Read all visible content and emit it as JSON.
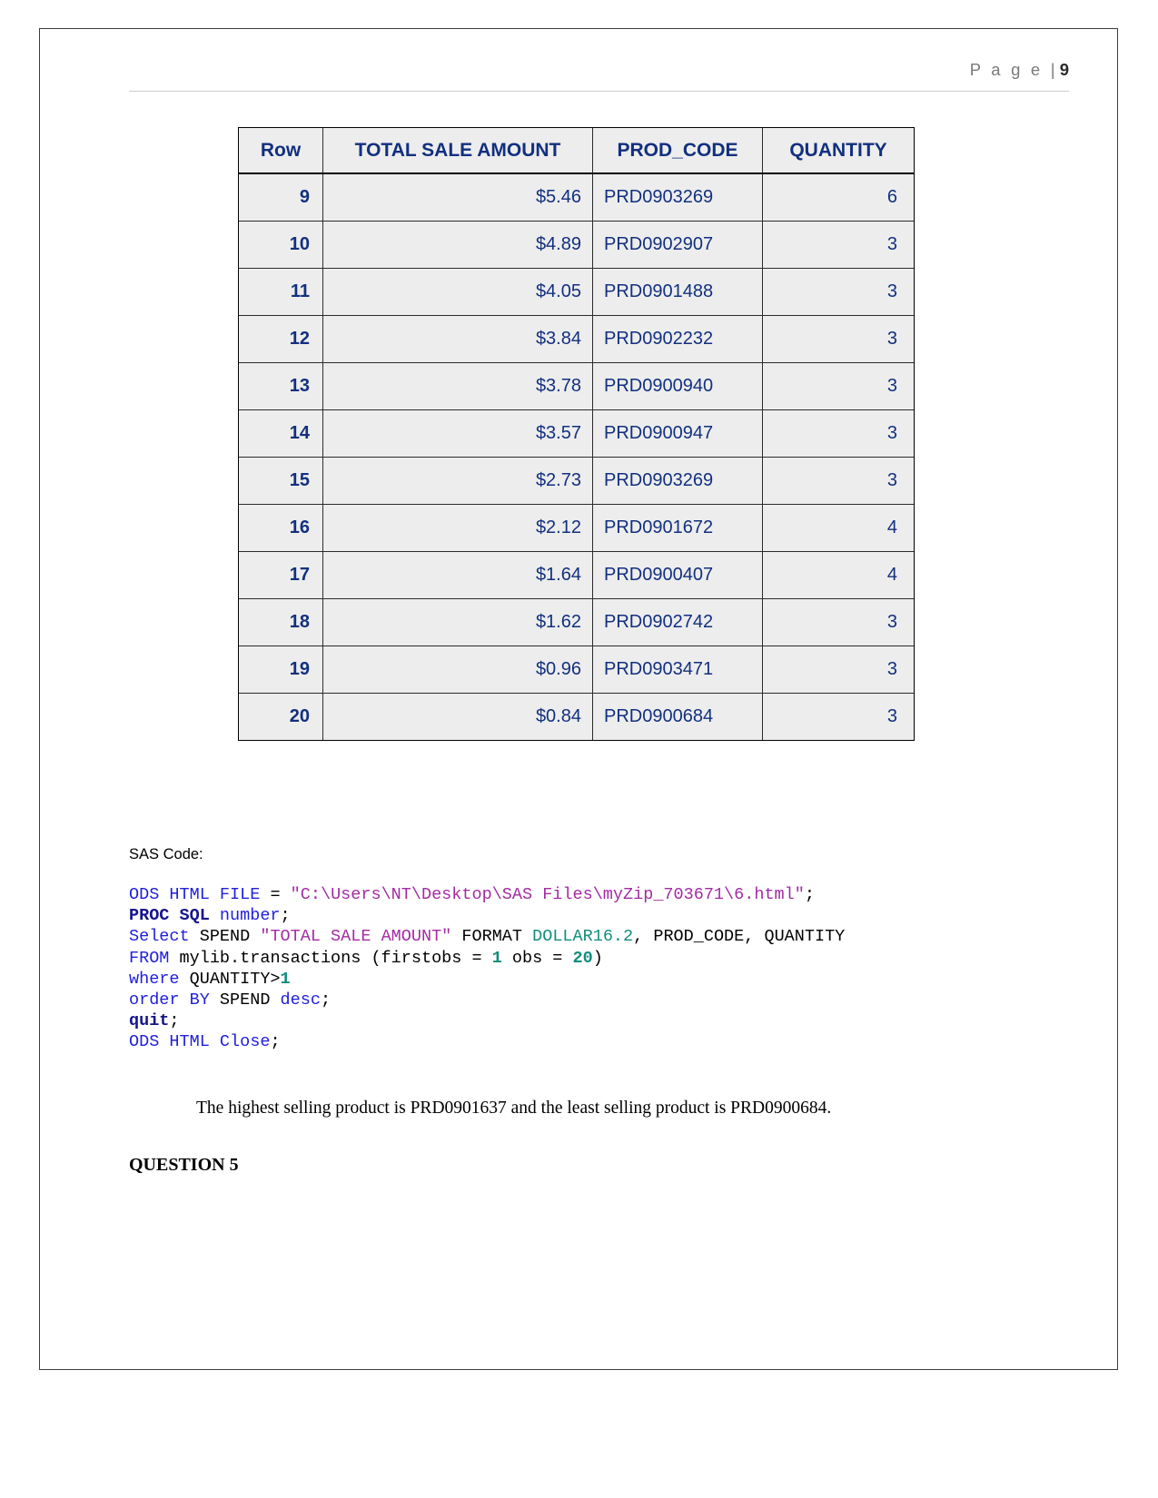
{
  "header": {
    "page_word": "P a g e ",
    "separator": "| ",
    "page_number": "9"
  },
  "table": {
    "columns": [
      "Row",
      "TOTAL SALE AMOUNT",
      "PROD_CODE",
      "QUANTITY"
    ],
    "rows": [
      {
        "row": "9",
        "amount": "$5.46",
        "prod_code": "PRD0903269",
        "quantity": "6"
      },
      {
        "row": "10",
        "amount": "$4.89",
        "prod_code": "PRD0902907",
        "quantity": "3"
      },
      {
        "row": "11",
        "amount": "$4.05",
        "prod_code": "PRD0901488",
        "quantity": "3"
      },
      {
        "row": "12",
        "amount": "$3.84",
        "prod_code": "PRD0902232",
        "quantity": "3"
      },
      {
        "row": "13",
        "amount": "$3.78",
        "prod_code": "PRD0900940",
        "quantity": "3"
      },
      {
        "row": "14",
        "amount": "$3.57",
        "prod_code": "PRD0900947",
        "quantity": "3"
      },
      {
        "row": "15",
        "amount": "$2.73",
        "prod_code": "PRD0903269",
        "quantity": "3"
      },
      {
        "row": "16",
        "amount": "$2.12",
        "prod_code": "PRD0901672",
        "quantity": "4"
      },
      {
        "row": "17",
        "amount": "$1.64",
        "prod_code": "PRD0900407",
        "quantity": "4"
      },
      {
        "row": "18",
        "amount": "$1.62",
        "prod_code": "PRD0902742",
        "quantity": "3"
      },
      {
        "row": "19",
        "amount": "$0.96",
        "prod_code": "PRD0903471",
        "quantity": "3"
      },
      {
        "row": "20",
        "amount": "$0.84",
        "prod_code": "PRD0900684",
        "quantity": "3"
      }
    ]
  },
  "sas_section": {
    "label": "SAS Code:",
    "code_lines": [
      {
        "tokens": [
          {
            "t": "ODS HTML FILE ",
            "c": "kw"
          },
          {
            "t": "= ",
            "c": "plain"
          },
          {
            "t": "\"C:\\Users\\NT\\Desktop\\SAS Files\\myZip_703671\\6.html\"",
            "c": "str"
          },
          {
            "t": ";",
            "c": "plain"
          }
        ]
      },
      {
        "tokens": [
          {
            "t": "PROC SQL ",
            "c": "kwb"
          },
          {
            "t": "number",
            "c": "kw"
          },
          {
            "t": ";",
            "c": "plain"
          }
        ]
      },
      {
        "tokens": [
          {
            "t": "Select",
            "c": "kw"
          },
          {
            "t": " SPEND ",
            "c": "plain"
          },
          {
            "t": "\"TOTAL SALE AMOUNT\"",
            "c": "str"
          },
          {
            "t": " FORMAT ",
            "c": "plain"
          },
          {
            "t": "DOLLAR16.2",
            "c": "fmt"
          },
          {
            "t": ", PROD_CODE, QUANTITY",
            "c": "plain"
          }
        ]
      },
      {
        "tokens": [
          {
            "t": "FROM",
            "c": "kw"
          },
          {
            "t": " mylib.transactions (firstobs = ",
            "c": "plain"
          },
          {
            "t": "1",
            "c": "num"
          },
          {
            "t": " obs = ",
            "c": "plain"
          },
          {
            "t": "20",
            "c": "num"
          },
          {
            "t": ")",
            "c": "plain"
          }
        ]
      },
      {
        "tokens": [
          {
            "t": "where",
            "c": "kw"
          },
          {
            "t": " QUANTITY>",
            "c": "plain"
          },
          {
            "t": "1",
            "c": "num"
          }
        ]
      },
      {
        "tokens": [
          {
            "t": "order BY",
            "c": "kw"
          },
          {
            "t": " SPEND ",
            "c": "plain"
          },
          {
            "t": "desc",
            "c": "kw"
          },
          {
            "t": ";",
            "c": "plain"
          }
        ]
      },
      {
        "tokens": [
          {
            "t": "quit",
            "c": "kwb"
          },
          {
            "t": ";",
            "c": "plain"
          }
        ]
      },
      {
        "tokens": [
          {
            "t": "ODS HTML Close",
            "c": "kw"
          },
          {
            "t": ";",
            "c": "plain"
          }
        ]
      }
    ]
  },
  "conclusion": "The highest selling product is PRD0901637 and the least selling product is PRD0900684.",
  "question_heading": "QUESTION 5"
}
